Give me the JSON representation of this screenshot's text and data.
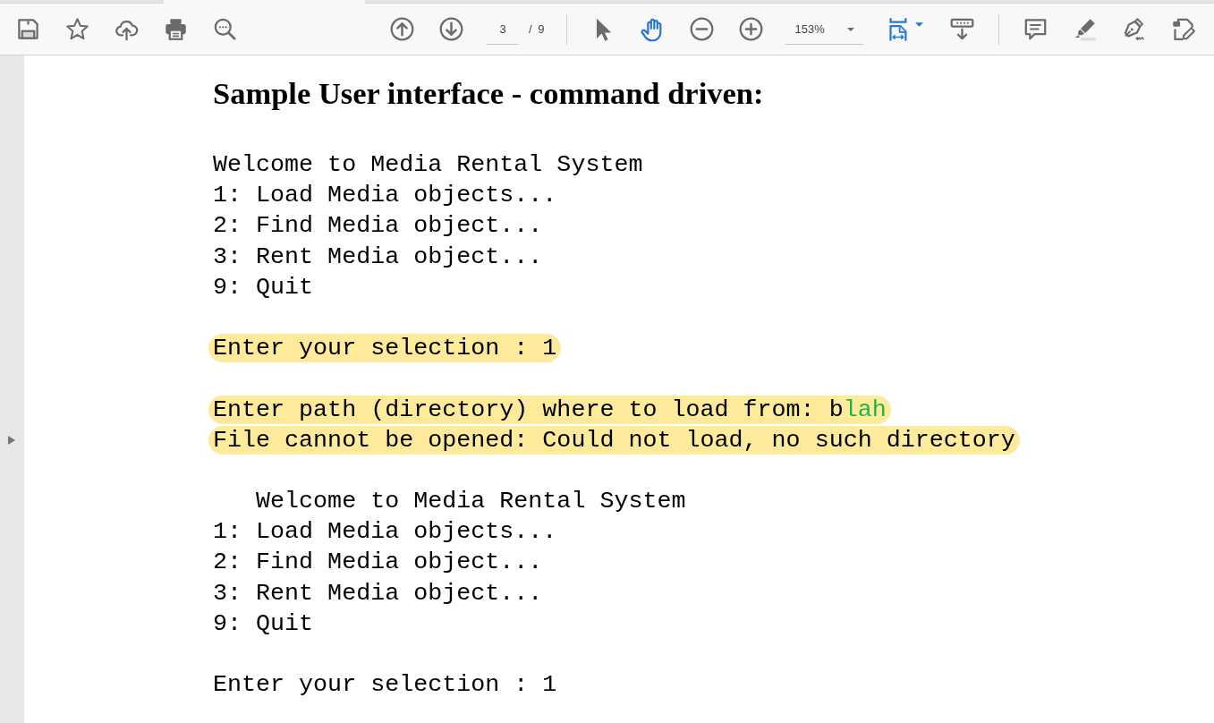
{
  "toolbar": {
    "page_field": {
      "value": "3"
    },
    "page_count": "/ 9",
    "tools": [
      {
        "kind": "select",
        "selected": false
      },
      {
        "kind": "hand",
        "selected": true
      }
    ],
    "zoom_field": {
      "value": "153%"
    }
  },
  "document": {
    "heading": "Sample User interface - command driven:",
    "blocks": [
      {
        "lines": [
          {
            "text": "Welcome to Media Rental System",
            "highlighted": false
          },
          {
            "text": "1: Load Media objects...",
            "highlighted": false
          },
          {
            "text": "2: Find Media object...",
            "highlighted": false
          },
          {
            "text": "3: Rent Media object...",
            "highlighted": false
          },
          {
            "text": "9: Quit",
            "highlighted": false
          }
        ]
      },
      {
        "lines": [
          {
            "text": "Enter your selection : 1",
            "highlighted": true
          }
        ]
      },
      {
        "lines": [
          {
            "segments": [
              {
                "kind": "plain",
                "text": "Enter path (directory) where to load from: b"
              },
              {
                "kind": "typed",
                "text": "lah"
              }
            ],
            "highlighted": true
          },
          {
            "text": "File cannot be opened: Could not load, no such directory",
            "highlighted": true
          }
        ]
      },
      {
        "lines": [
          {
            "text": "   Welcome to Media Rental System",
            "highlighted": false
          },
          {
            "text": "1: Load Media objects...",
            "highlighted": false
          },
          {
            "text": "2: Find Media object...",
            "highlighted": false
          },
          {
            "text": "3: Rent Media object...",
            "highlighted": false
          },
          {
            "text": "9: Quit",
            "highlighted": false
          }
        ]
      },
      {
        "lines": [
          {
            "text": "Enter your selection : 1",
            "highlighted": false
          }
        ]
      }
    ]
  }
}
